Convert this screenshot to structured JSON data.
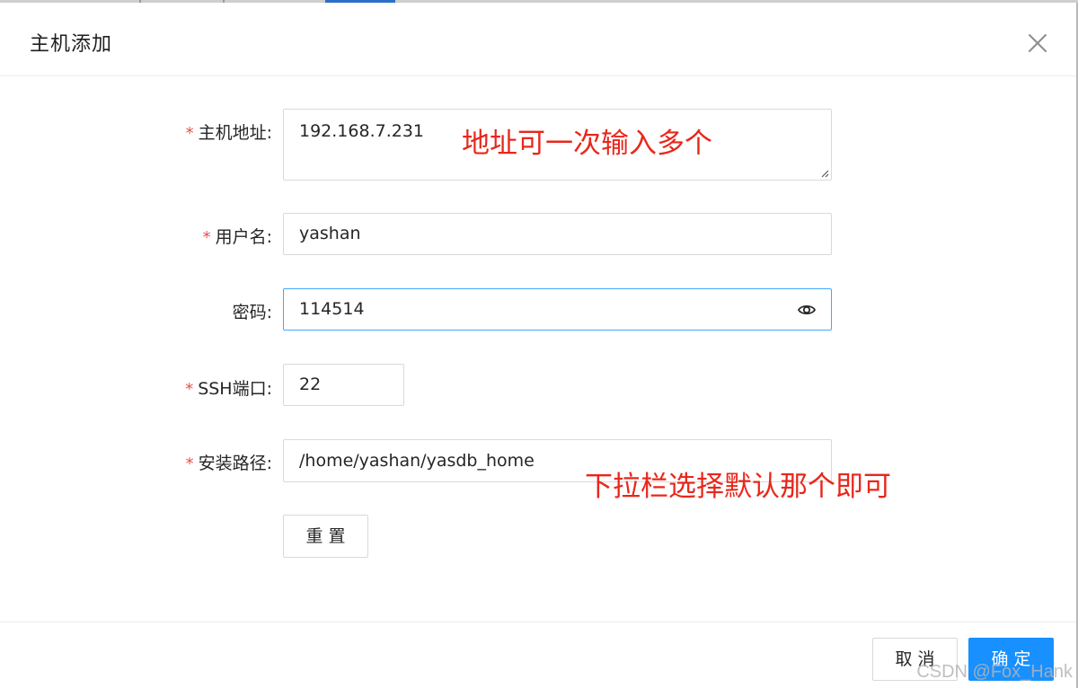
{
  "dialog": {
    "title": "主机添加",
    "close_icon": "close-icon"
  },
  "form": {
    "host_address": {
      "required": true,
      "label": "主机地址:",
      "value": "192.168.7.231"
    },
    "username": {
      "required": true,
      "label": "用户名:",
      "value": "yashan"
    },
    "password": {
      "required": false,
      "label": "密码:",
      "value": "114514",
      "icon": "eye-icon"
    },
    "ssh_port": {
      "required": true,
      "label": "SSH端口:",
      "value": "22"
    },
    "install_path": {
      "required": true,
      "label": "安装路径:",
      "value": "/home/yashan/yasdb_home"
    },
    "reset_label": "重置",
    "required_mark": "*"
  },
  "annotations": {
    "address_note": "地址可一次输入多个",
    "path_note": "下拉栏选择默认那个即可"
  },
  "footer": {
    "cancel_label": "取消",
    "confirm_label": "确定"
  },
  "watermark": "CSDN @Fox_Hank",
  "colors": {
    "primary": "#1890ff",
    "focus_border": "#40a9ff",
    "required": "#e65151",
    "annotation": "#e8271b"
  }
}
